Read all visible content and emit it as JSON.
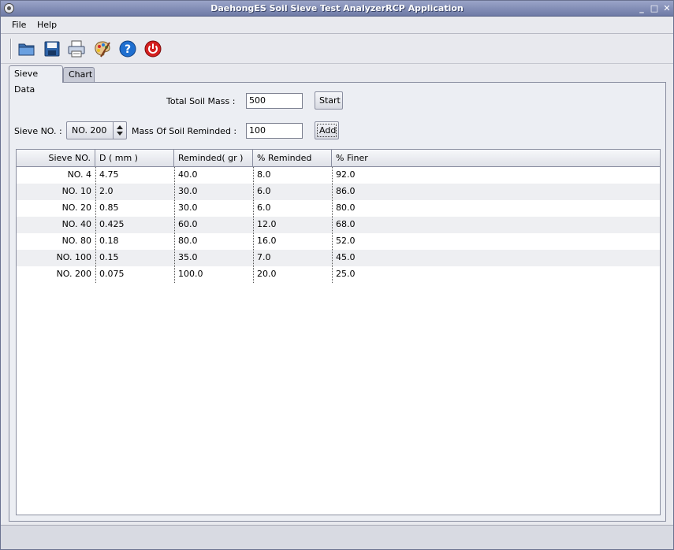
{
  "window": {
    "title": "DaehongES Soil Sieve Test AnalyzerRCP Application",
    "minimize": "_",
    "maximize": "□",
    "close": "✕"
  },
  "menu": [
    "File",
    "Help"
  ],
  "toolbar": {
    "icons": [
      "open-folder-icon",
      "save-icon",
      "print-icon",
      "palette-icon",
      "help-icon",
      "power-icon"
    ]
  },
  "tabs": [
    "Sieve Data",
    "Chart"
  ],
  "form": {
    "total_mass_label": "Total Soil Mass :",
    "total_mass_value": "500",
    "start_label": "Start",
    "sieve_label": "Sieve NO. :",
    "sieve_value": "NO. 200",
    "mass_reminded_label": "Mass Of Soil Reminded :",
    "mass_reminded_value": "100",
    "add_label": "Add"
  },
  "table": {
    "columns": [
      "Sieve NO.",
      "D ( mm )",
      "Reminded( gr )",
      "% Reminded",
      "% Finer"
    ],
    "rows": [
      [
        "NO. 4",
        "4.75",
        "40.0",
        "8.0",
        "92.0"
      ],
      [
        "NO. 10",
        "2.0",
        "30.0",
        "6.0",
        "86.0"
      ],
      [
        "NO. 20",
        "0.85",
        "30.0",
        "6.0",
        "80.0"
      ],
      [
        "NO. 40",
        "0.425",
        "60.0",
        "12.0",
        "68.0"
      ],
      [
        "NO. 80",
        "0.18",
        "80.0",
        "16.0",
        "52.0"
      ],
      [
        "NO. 100",
        "0.15",
        "35.0",
        "7.0",
        "45.0"
      ],
      [
        "NO. 200",
        "0.075",
        "100.0",
        "20.0",
        "25.0"
      ]
    ]
  }
}
